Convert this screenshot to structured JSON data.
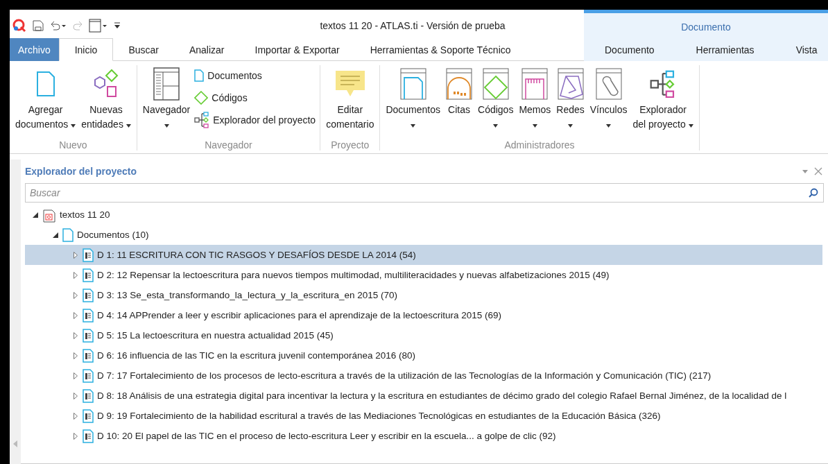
{
  "window": {
    "title": "textos 11 20 - ATLAS.ti - Versión de prueba",
    "context_group": "Documento"
  },
  "ribbon_tabs": [
    {
      "label": "Archivo",
      "kind": "file",
      "selected": false
    },
    {
      "label": "Inicio",
      "kind": "normal",
      "selected": true
    },
    {
      "label": "Buscar",
      "kind": "normal",
      "selected": false
    },
    {
      "label": "Analizar",
      "kind": "normal",
      "selected": false
    },
    {
      "label": "Importar & Exportar",
      "kind": "normal",
      "selected": false
    },
    {
      "label": "Herramientas & Soporte Técnico",
      "kind": "normal",
      "selected": false
    },
    {
      "label": "Documento",
      "kind": "context",
      "selected": false
    },
    {
      "label": "Herramientas",
      "kind": "context",
      "selected": false
    },
    {
      "label": "Vista",
      "kind": "context",
      "selected": false
    }
  ],
  "ribbon_groups": [
    {
      "label": "Nuevo",
      "items": [
        {
          "kind": "large",
          "lines": [
            "Agregar",
            "documentos"
          ],
          "dropdown": true
        },
        {
          "kind": "large",
          "lines": [
            "Nuevas",
            "entidades"
          ],
          "dropdown": true
        }
      ]
    },
    {
      "label": "Navegador",
      "items": [
        {
          "kind": "large",
          "lines": [
            "Navegador"
          ],
          "dropdown": true
        },
        {
          "kind": "stack",
          "entries": [
            "Documentos",
            "Códigos",
            "Explorador del proyecto"
          ]
        }
      ]
    },
    {
      "label": "Proyecto",
      "items": [
        {
          "kind": "large",
          "lines": [
            "Editar",
            "comentario"
          ],
          "dropdown": false
        }
      ]
    },
    {
      "label": "Administradores",
      "items": [
        {
          "kind": "large",
          "lines": [
            "Documentos"
          ],
          "dropdown": true
        },
        {
          "kind": "large",
          "lines": [
            "Citas"
          ],
          "dropdown": false
        },
        {
          "kind": "large",
          "lines": [
            "Códigos"
          ],
          "dropdown": true
        },
        {
          "kind": "large",
          "lines": [
            "Memos"
          ],
          "dropdown": true
        },
        {
          "kind": "large",
          "lines": [
            "Redes"
          ],
          "dropdown": true
        },
        {
          "kind": "large",
          "lines": [
            "Vínculos"
          ],
          "dropdown": true
        },
        {
          "kind": "large",
          "lines": [
            "Explorador",
            "del proyecto"
          ],
          "dropdown": true
        }
      ]
    }
  ],
  "panel": {
    "title": "Explorador del proyecto",
    "search": {
      "placeholder": "Buscar"
    },
    "tree": [
      {
        "label": "textos 11 20",
        "expanded": true,
        "selected": false,
        "children": [
          {
            "label": "Documentos (10)",
            "expanded": true,
            "selected": false,
            "children": [
              {
                "label": "D 1: 11 ESCRITURA CON TIC RASGOS Y DESAFÍOS DESDE LA 2014 (54)",
                "expanded": false,
                "selected": true
              },
              {
                "label": "D 2: 12 Repensar la lectoescritura para nuevos tiempos multimodad, multiliteracidades y nuevas alfabetizaciones 2015 (49)",
                "expanded": false,
                "selected": false
              },
              {
                "label": "D 3: 13 Se_esta_transformando_la_lectura_y_la_escritura_en 2015 (70)",
                "expanded": false,
                "selected": false
              },
              {
                "label": "D 4: 14 APPrender a leer y escribir aplicaciones para el aprendizaje de la lectoescritura 2015 (69)",
                "expanded": false,
                "selected": false
              },
              {
                "label": "D 5: 15 La lectoescritura en nuestra actualidad 2015 (45)",
                "expanded": false,
                "selected": false
              },
              {
                "label": "D 6: 16 influencia de las TIC en la escritura juvenil contemporánea 2016 (80)",
                "expanded": false,
                "selected": false
              },
              {
                "label": "D 7: 17 Fortalecimiento de los procesos de lecto-escritura a través de la utilización de las Tecnologías de la Información y Comunicación (TIC) (217)",
                "expanded": false,
                "selected": false
              },
              {
                "label": "D 8: 18 Análisis de una estrategia digital para incentivar la lectura y la escritura en estudiantes de décimo grado del colegio Rafael Bernal Jiménez, de la localidad de l",
                "expanded": false,
                "selected": false
              },
              {
                "label": "D 9: 19 Fortalecimiento de la habilidad escritural a través de las Mediaciones Tecnológicas en estudiantes de la Educación Básica (326)",
                "expanded": false,
                "selected": false
              },
              {
                "label": "D 10: 20 El papel de las TIC en el proceso de lecto-escritura Leer y escribir en la escuela... a golpe de clic (92)",
                "expanded": false,
                "selected": false
              }
            ]
          }
        ]
      }
    ]
  }
}
